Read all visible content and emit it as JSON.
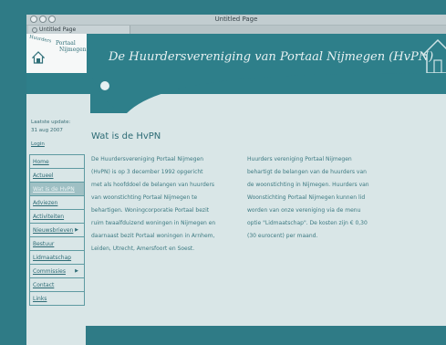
{
  "window": {
    "title": "Untitled Page",
    "tab_label": "Untitled Page"
  },
  "header": {
    "logo_line1": "Huurders",
    "logo_line2": "Portaal",
    "logo_line3": "Nijmegen",
    "title": "De Huurdersvereniging van Portaal Nijmegen (HvPN)"
  },
  "sidebar": {
    "update_label": "Laatste update:",
    "update_date": "31 aug 2007",
    "login": "Login",
    "menu": [
      {
        "label": "Home"
      },
      {
        "label": "Actueel"
      },
      {
        "label": "Wat is de HvPN"
      },
      {
        "label": "Adviezen"
      },
      {
        "label": "Activiteiten"
      },
      {
        "label": "Nieuwsbrieven"
      },
      {
        "label": "Bestuur"
      },
      {
        "label": "Lidmaatschap"
      },
      {
        "label": "Commissies"
      },
      {
        "label": "Contact"
      },
      {
        "label": "Links"
      }
    ]
  },
  "main": {
    "heading": "Wat is de HvPN",
    "col1": [
      "De Huurdersvereniging Portaal Nijmegen",
      "(HvPN) is op 3 december 1992 opgericht",
      "met als hoofddoel de belangen van huurders",
      "van woonstichting Portaal Nijmegen te",
      "behartigen. Woningcorporatie Portaal bezit",
      "ruim twaalfduizend woningen in Nijmegen en",
      "daarnaast bezit Portaal woningen in Arnhem,",
      "Leiden, Utrecht, Amersfoort en Soest."
    ],
    "col2": [
      "Huurders vereniging Portaal Nijmegen",
      "behartigt de belangen van de huurders van",
      "de woonstichting in Nijmegen. Huurders van",
      "Woonstichting Portaal Nijmegen kunnen lid",
      "worden van onze vereniging via de menu",
      "optie \"Lidmaatschap\". De kosten zijn € 0,30",
      "(30 eurocent) per maand."
    ]
  },
  "colors": {
    "teal": "#2e7f8a",
    "page_bg": "#d9e6e7",
    "menu_active": "#9fc0c4",
    "text": "#3d7a82"
  }
}
